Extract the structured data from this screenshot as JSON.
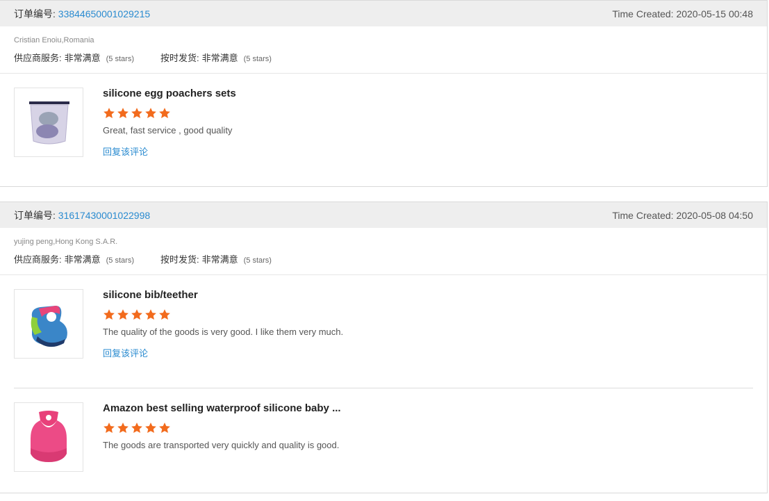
{
  "orders": [
    {
      "order_label": "订单编号:",
      "order_number": "33844650001029215",
      "time_label": "Time Created:",
      "time_value": "2020-05-15 00:48",
      "buyer": "Cristian Enoiu,Romania",
      "supplier_service_label": "供应商服务:",
      "supplier_service_value": "非常满意",
      "supplier_service_stars": "(5 stars)",
      "ontime_label": "按时发货:",
      "ontime_value": "非常满意",
      "ontime_stars": "(5 stars)",
      "products": [
        {
          "title": "silicone egg poachers sets",
          "rating": 5,
          "comment": "Great, fast service , good quality",
          "reply_label": "回复该评论",
          "thumb_icon": "silicone-food-bag-image"
        }
      ]
    },
    {
      "order_label": "订单编号:",
      "order_number": "31617430001022998",
      "time_label": "Time Created:",
      "time_value": "2020-05-08 04:50",
      "buyer": "yujing peng,Hong Kong S.A.R.",
      "supplier_service_label": "供应商服务:",
      "supplier_service_value": "非常满意",
      "supplier_service_stars": "(5 stars)",
      "ontime_label": "按时发货:",
      "ontime_value": "非常满意",
      "ontime_stars": "(5 stars)",
      "products": [
        {
          "title": "silicone bib/teether",
          "rating": 5,
          "comment": "The quality of the goods is very good. I like them very much.",
          "reply_label": "回复该评论",
          "thumb_icon": "silicone-bib-blue-image"
        },
        {
          "title": "Amazon best selling waterproof silicone baby ...",
          "rating": 5,
          "comment": "The goods are transported very quickly and quality is good.",
          "thumb_icon": "silicone-bib-pink-image"
        }
      ]
    }
  ],
  "colors": {
    "star": "#f26b1d",
    "link": "#2a8bd0",
    "header_bg": "#eeeeee"
  }
}
